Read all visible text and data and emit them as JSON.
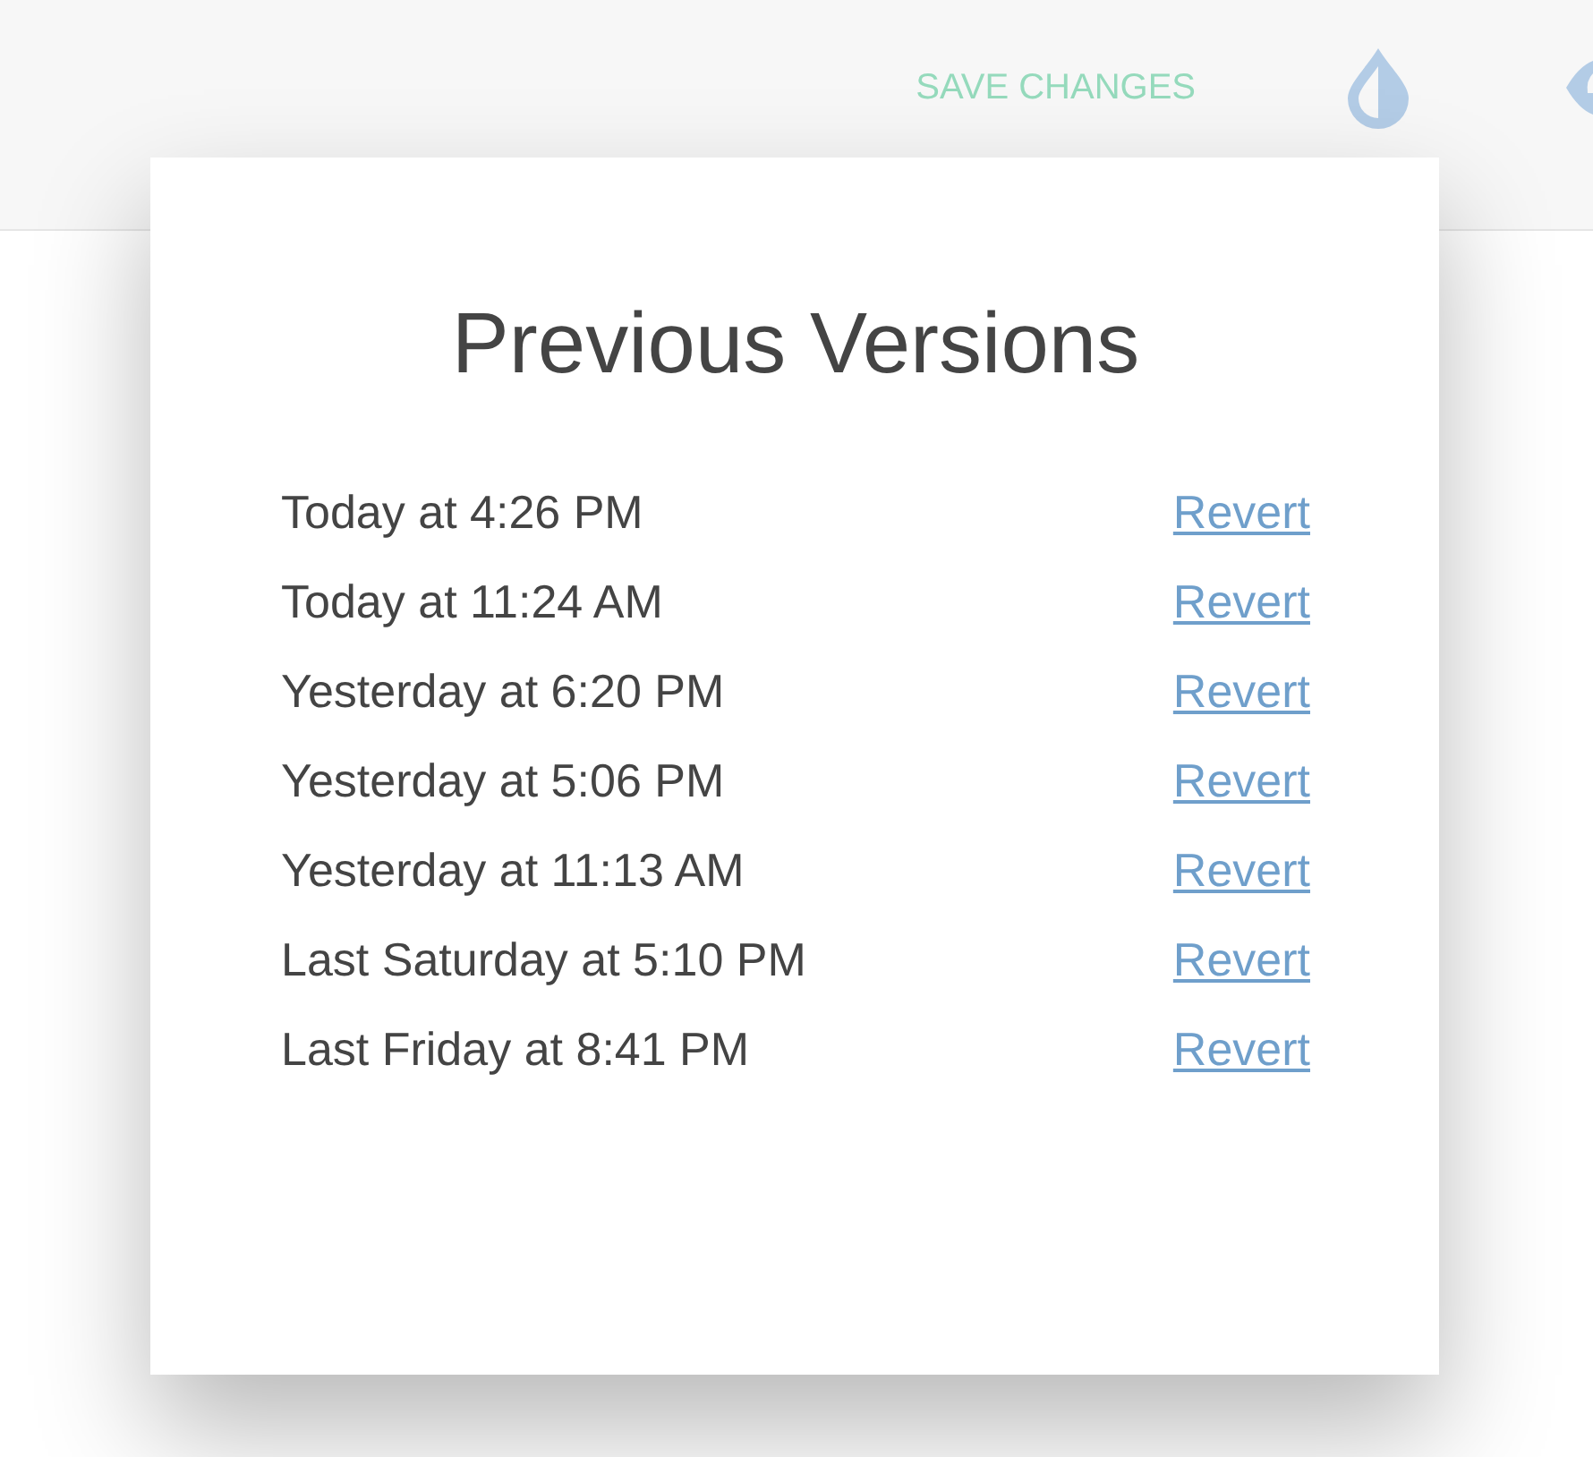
{
  "header": {
    "save_button": "SAVE CHANGES"
  },
  "dialog": {
    "title": "Previous Versions",
    "versions": [
      {
        "time": "Today at 4:26 PM",
        "action": "Revert"
      },
      {
        "time": "Today at 11:24 AM",
        "action": "Revert"
      },
      {
        "time": "Yesterday at 6:20 PM",
        "action": "Revert"
      },
      {
        "time": "Yesterday at 5:06 PM",
        "action": "Revert"
      },
      {
        "time": "Yesterday at 11:13 AM",
        "action": "Revert"
      },
      {
        "time": "Last Saturday at 5:10 PM",
        "action": "Revert"
      },
      {
        "time": "Last Friday at 8:41 PM",
        "action": "Revert"
      }
    ]
  }
}
